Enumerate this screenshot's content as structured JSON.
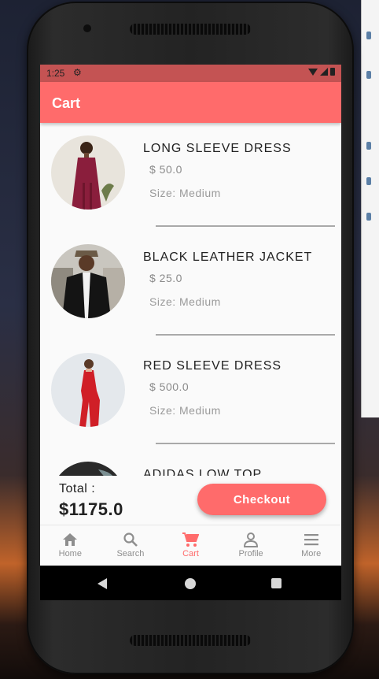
{
  "status_bar": {
    "time": "1:25"
  },
  "app_bar": {
    "title": "Cart"
  },
  "cart_items": [
    {
      "name": "LONG SLEEVE DRESS",
      "price": "$ 50.0",
      "size": "Size: Medium"
    },
    {
      "name": "BLACK LEATHER JACKET",
      "price": "$ 25.0",
      "size": "Size: Medium"
    },
    {
      "name": "RED SLEEVE DRESS",
      "price": "$ 500.0",
      "size": "Size: Medium"
    },
    {
      "name": "ADIDAS LOW TOP",
      "price": "",
      "size": ""
    }
  ],
  "footer": {
    "total_label": "Total :",
    "total_value": "$1175.0",
    "checkout_label": "Checkout"
  },
  "bottom_nav": [
    {
      "label": "Home",
      "icon": "home-icon"
    },
    {
      "label": "Search",
      "icon": "search-icon"
    },
    {
      "label": "Cart",
      "icon": "cart-icon",
      "active": true
    },
    {
      "label": "Profile",
      "icon": "profile-icon"
    },
    {
      "label": "More",
      "icon": "menu-icon"
    }
  ],
  "colors": {
    "accent": "#ff6b6b",
    "status_bar": "#c45353",
    "nav_inactive": "#8e8e8e"
  }
}
